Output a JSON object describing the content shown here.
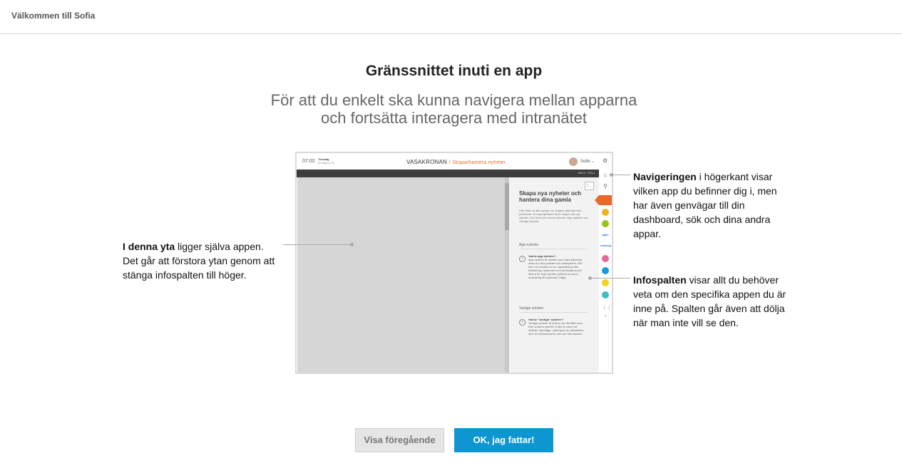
{
  "header": {
    "title": "Välkommen till Sofia"
  },
  "main": {
    "heading": "Gränssnittet inuti en app",
    "subheading_lines": [
      "För att du enkelt ska kunna navigera mellan apparna",
      "och fortsätta interagera med intranätet"
    ]
  },
  "mock": {
    "time": "07:02",
    "day": "Torsdag",
    "date": "20 Maj (v.21)",
    "brand": "VASAKRONAN",
    "page_title": "Skapa/hantera nyheter",
    "user": "Sofie",
    "toolbar_actions": "DELA · FÖLJ",
    "info": {
      "title": "Skapa nya nyheter och hantera dina gamla",
      "intro": "Här hittar du alla nyheter du tidigare påbörjat eller publicerat. Du kan självklart även skapa helt nya nyheter. Det finns två sorters nyheter: App-nyheter och Vanliga nyheter.",
      "sections": [
        {
          "heading": "App-nyheter",
          "question": "Vad är app-nyheter?",
          "text": "App-nyheter är nyheter som bara påverkar vissa av våra portaler och stödsystem. Det kan t.ex handla om en uppdatering eller förändring i systemet som användarna bör känna till. App-nyheter publiceras bara i anslutning till systemet i fråga."
        },
        {
          "heading": "Vanliga nyheter",
          "question": "Vad är \"vanliga\" nyheter?",
          "text": "Vanliga nyheter är precis vad det låter som. Den sortens nyheter vi alla är vana vid. Artiklar, reportage, olika typer av aktualiteter som är intressanta för oss och vår bransch."
        }
      ]
    },
    "nav_colors": [
      "#f0b020",
      "#9cc21a",
      "#2a7fd4",
      "#e0679a",
      "#1a9ad6",
      "#f2d21f",
      "#3bbec7"
    ],
    "nav_labels": [
      "agile",
      "mashup"
    ]
  },
  "annotations": {
    "left": {
      "bold": "I denna yta",
      "text": " ligger själva appen. Det går att förstora ytan genom att stänga infospalten till höger."
    },
    "nav": {
      "bold": "Navigeringen",
      "text": " i högerkant visar vilken app du befinner dig i, men har även genvägar till din dashboard, sök och dina andra appar."
    },
    "info": {
      "bold": "Infospalten",
      "text": " visar allt du behöver veta om den specifika appen du är inne på. Spalten går även att dölja när man inte vill se den."
    }
  },
  "buttons": {
    "previous": "Visa föregående",
    "ok": "OK, jag fattar!"
  }
}
